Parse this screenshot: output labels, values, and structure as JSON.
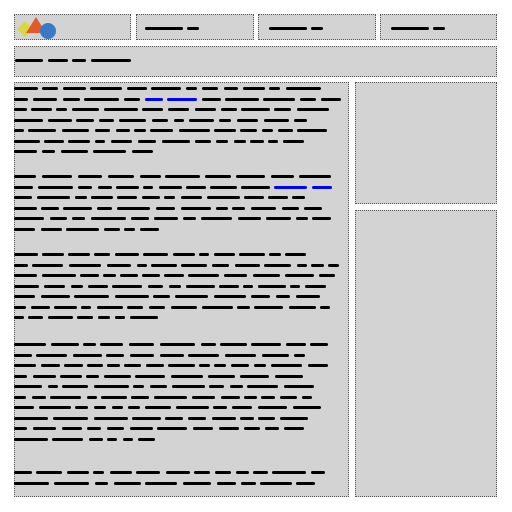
{
  "page": {
    "background": "#ffffff",
    "panel_color": "#d3d3d3",
    "border_color": "#555555",
    "text_color": "#000000",
    "link_color": "#0000ff"
  },
  "logo": {
    "icon_name": "logo-icon",
    "shapes": {
      "diamond": "#d8d840",
      "triangle": "#e25a2a",
      "circle": "#3a78c8"
    }
  },
  "nav": {
    "items": [
      {
        "id": "nav-item-1"
      },
      {
        "id": "nav-item-2"
      },
      {
        "id": "nav-item-3"
      }
    ]
  },
  "header": {
    "id": "page-title"
  },
  "main": {
    "paragraphs": [
      {
        "id": "paragraph-1",
        "lines": 7
      },
      {
        "id": "paragraph-2",
        "lines": 6
      },
      {
        "id": "paragraph-3",
        "lines": 7
      },
      {
        "id": "paragraph-4",
        "lines": 10
      },
      {
        "id": "paragraph-5",
        "lines": 2
      }
    ]
  },
  "sidebar": {
    "panels": [
      {
        "id": "sidebar-panel-top"
      },
      {
        "id": "sidebar-panel-bottom"
      }
    ]
  }
}
